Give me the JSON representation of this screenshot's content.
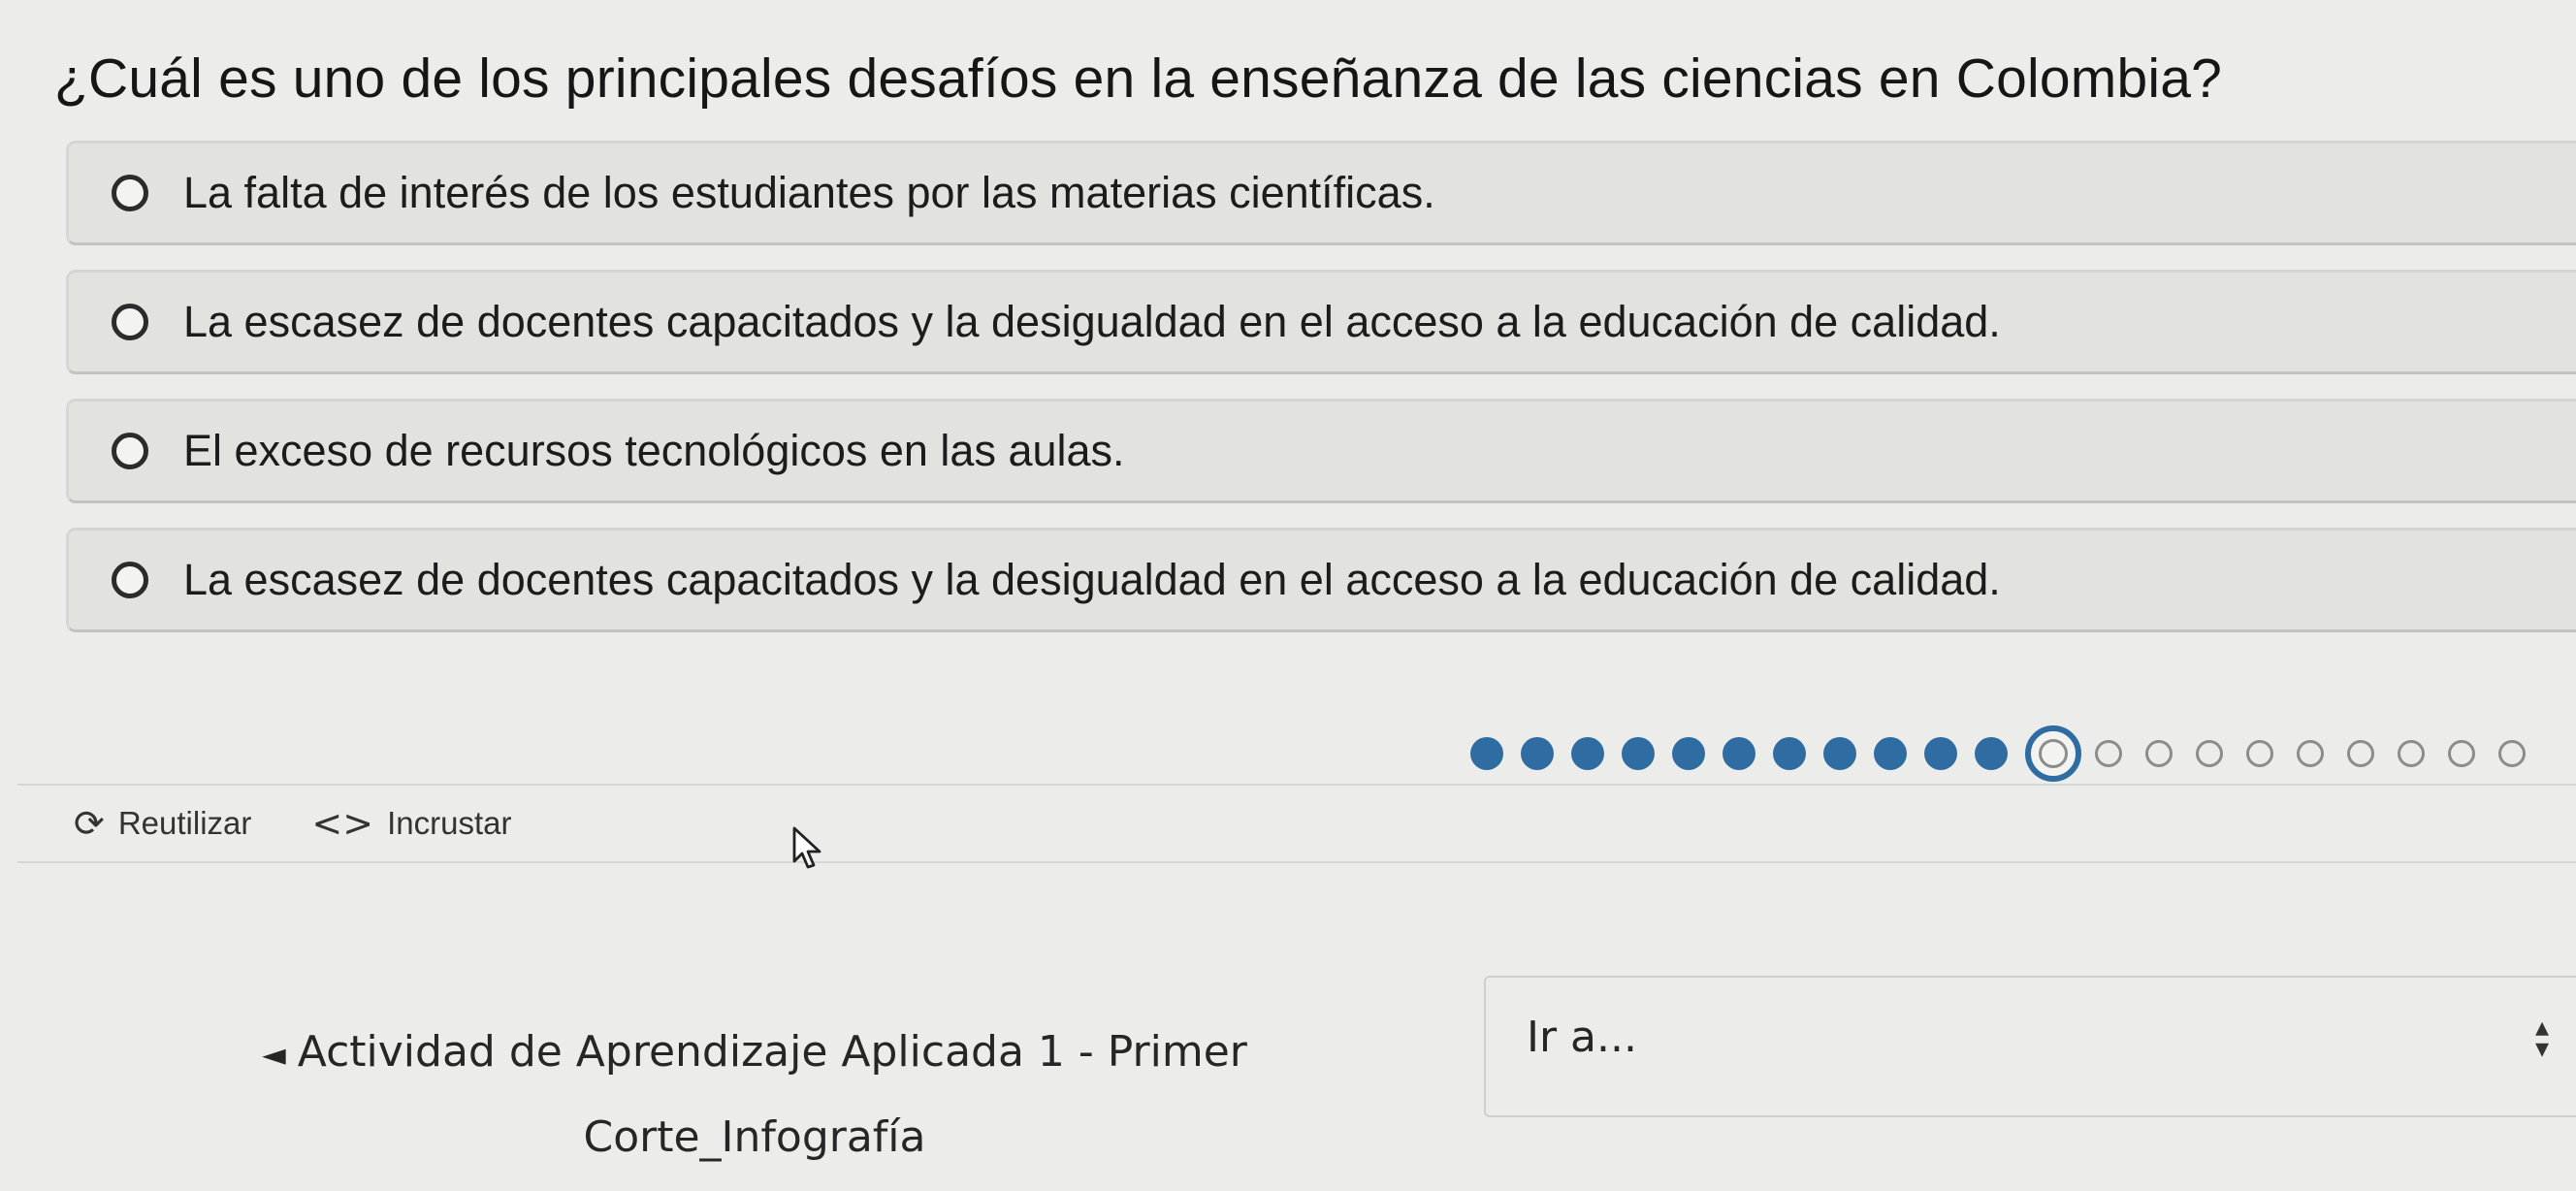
{
  "question": {
    "text": "¿Cuál es uno de los principales desafíos en la enseñanza de las ciencias en Colombia?"
  },
  "options": [
    {
      "label": "La falta de interés de los estudiantes por las materias científicas.",
      "selected": false
    },
    {
      "label": "La escasez de docentes capacitados y la desigualdad en el acceso a la educación de calidad.",
      "selected": false
    },
    {
      "label": "El exceso de recursos tecnológicos en las aulas.",
      "selected": false
    },
    {
      "label": "La escasez de docentes capacitados y la desigualdad en el acceso a la educación de calidad.",
      "selected": false
    }
  ],
  "progress": {
    "completed": 11,
    "current": 12,
    "total": 21,
    "done_color": "#2e6ca2"
  },
  "toolbar": {
    "reuse_label": "Reutilizar",
    "reuse_icon": "refresh-icon",
    "embed_label": "Incrustar",
    "embed_icon": "code-icon"
  },
  "navigation": {
    "prev_activity_label": "Actividad de Aprendizaje Aplicada 1 - Primer Corte_Infografía",
    "prev_icon": "arrow-left-icon",
    "jump_to_label": "Ir a..."
  }
}
